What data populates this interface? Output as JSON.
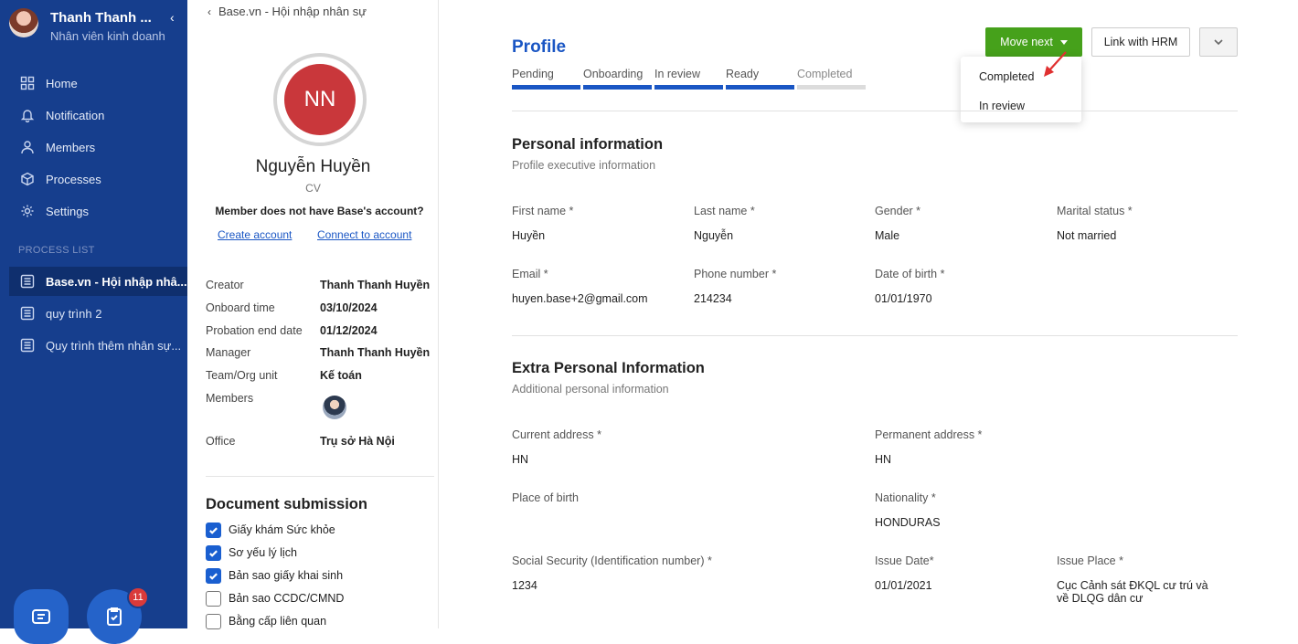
{
  "sidebar": {
    "user_name": "Thanh Thanh ...",
    "user_role": "Nhân viên kinh doanh",
    "collapse_icon": "‹",
    "nav": [
      {
        "label": "Home",
        "icon": "grid-icon"
      },
      {
        "label": "Notification",
        "icon": "bell-icon"
      },
      {
        "label": "Members",
        "icon": "user-icon"
      },
      {
        "label": "Processes",
        "icon": "cube-icon"
      },
      {
        "label": "Settings",
        "icon": "gear-icon"
      }
    ],
    "process_list_title": "PROCESS LIST",
    "processes": [
      {
        "label": "Base.vn - Hội nhập nhâ...",
        "active": true
      },
      {
        "label": "quy trình 2",
        "active": false
      },
      {
        "label": "Quy trình thêm nhân sự...",
        "active": false
      }
    ],
    "badge_count": "11"
  },
  "profile_panel": {
    "breadcrumb": "Base.vn - Hội nhập nhân sự",
    "initials": "NN",
    "name": "Nguyễn Huyền",
    "subtitle": "CV",
    "account_note": "Member does not have Base's account?",
    "create_account": "Create account",
    "connect_account": "Connect to account",
    "info": [
      {
        "key": "Creator",
        "value": "Thanh Thanh Huyền"
      },
      {
        "key": "Onboard time",
        "value": "03/10/2024"
      },
      {
        "key": "Probation end date",
        "value": "01/12/2024"
      },
      {
        "key": "Manager",
        "value": "Thanh Thanh Huyền"
      },
      {
        "key": "Team/Org unit",
        "value": "Kế toán"
      },
      {
        "key": "Members",
        "value": ""
      },
      {
        "key": "Office",
        "value": "Trụ sở Hà Nội"
      }
    ],
    "documents_title": "Document submission",
    "documents": [
      {
        "label": "Giấy khám Sức khỏe",
        "checked": true
      },
      {
        "label": "Sơ yếu lý lịch",
        "checked": true
      },
      {
        "label": "Bản sao giấy khai sinh",
        "checked": true
      },
      {
        "label": "Bản sao CCDC/CMND",
        "checked": false
      },
      {
        "label": "Bằng cấp liên quan",
        "checked": false
      }
    ]
  },
  "main": {
    "title": "Profile",
    "steps": [
      {
        "label": "Pending",
        "done": true
      },
      {
        "label": "Onboarding",
        "done": true
      },
      {
        "label": "In review",
        "done": true
      },
      {
        "label": "Ready",
        "done": true
      },
      {
        "label": "Completed",
        "done": false
      }
    ],
    "move_next_label": "Move next",
    "link_hrm_label": "Link with HRM",
    "dropdown": [
      "Completed",
      "In review"
    ],
    "personal": {
      "title": "Personal information",
      "subtitle": "Profile executive information",
      "fields": [
        {
          "label": "First name *",
          "value": "Huyền"
        },
        {
          "label": "Last name *",
          "value": "Nguyễn"
        },
        {
          "label": "Gender *",
          "value": "Male"
        },
        {
          "label": "Marital status *",
          "value": "Not married"
        },
        {
          "label": "Email *",
          "value": "huyen.base+2@gmail.com"
        },
        {
          "label": "Phone number *",
          "value": "214234"
        },
        {
          "label": "Date of birth *",
          "value": "01/01/1970"
        }
      ]
    },
    "extra": {
      "title": "Extra Personal Information",
      "subtitle": "Additional personal information",
      "fields": [
        {
          "label": "Current address *",
          "value": "HN"
        },
        {
          "label": "Permanent address *",
          "value": "HN"
        },
        {
          "label": "Place of birth",
          "value": ""
        },
        {
          "label": "Nationality *",
          "value": "HONDURAS"
        },
        {
          "label": "Social Security (Identification number) *",
          "value": "1234"
        },
        {
          "label": "Issue Date*",
          "value": "01/01/2021"
        },
        {
          "label": "Issue Place *",
          "value": "Cục Cảnh sát ĐKQL cư trú và về DLQG dân cư"
        }
      ]
    }
  }
}
